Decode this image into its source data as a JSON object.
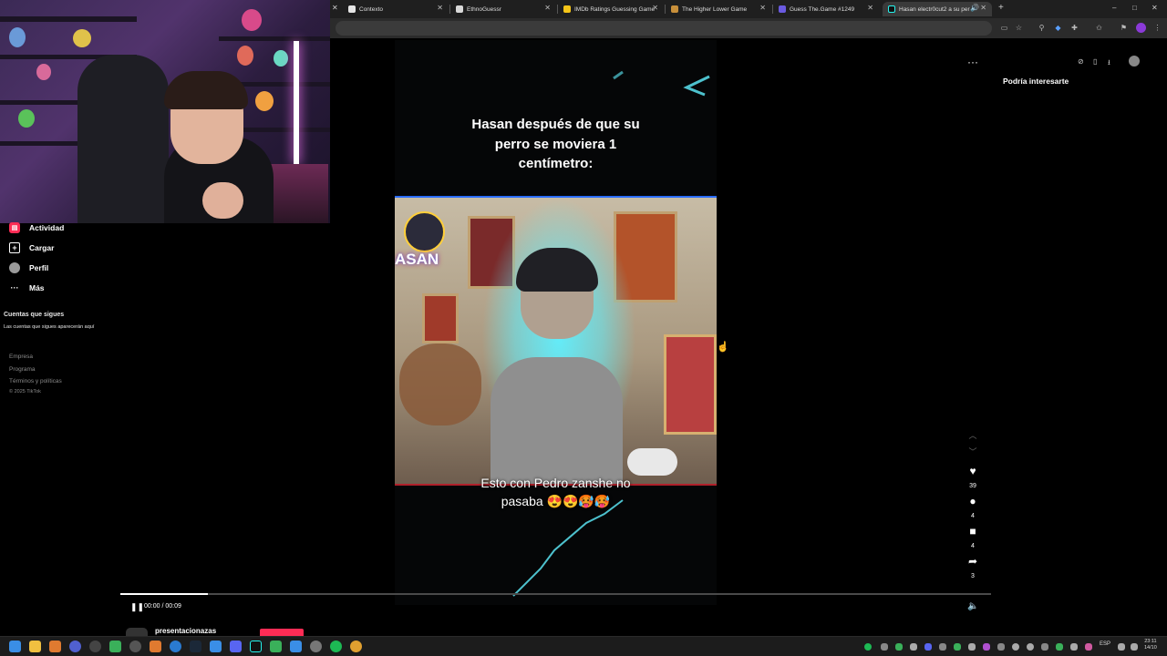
{
  "browser": {
    "tabs": [
      {
        "label": "Contexto"
      },
      {
        "label": "EthnoGuessr"
      },
      {
        "label": "IMDb Ratings Guessing Game"
      },
      {
        "label": "The Higher Lower Game"
      },
      {
        "label": "Guess The.Game #1249"
      },
      {
        "label": "Hasan electr0cut2 a su per"
      }
    ],
    "new_tab": "+",
    "window_controls": {
      "minimize": "–",
      "maximize": "□",
      "close": "✕"
    }
  },
  "sidebar": {
    "items": [
      {
        "label": "Actividad",
        "icon": "activity-icon"
      },
      {
        "label": "Cargar",
        "icon": "upload-icon"
      },
      {
        "label": "Perfil",
        "icon": "profile-avatar"
      },
      {
        "label": "Más",
        "icon": "more-icon"
      }
    ],
    "following_title": "Cuentas que sigues",
    "following_empty": "Las cuentas que sigues aparecerán aquí",
    "footer": [
      "Empresa",
      "Programa",
      "Términos y políticas",
      "© 2025 TikTok"
    ]
  },
  "video": {
    "caption_top": [
      "Hasan después de que su",
      "perro se moviera 1",
      "centímetro:"
    ],
    "caption_bottom": [
      "Esto con Pedro zanshe no",
      "pasaba 😍😍🥵🥵"
    ],
    "time": "00:00 / 00:09",
    "progress": 0.1
  },
  "actions": {
    "likes": "39",
    "comments": "4",
    "saves": "4",
    "shares": "3"
  },
  "right_rail": {
    "title": "Podría interesarte"
  },
  "bottom_bar": {
    "account_partial": "presentacionazas"
  },
  "taskbar": {
    "lang": "ESP",
    "time": "23:11",
    "date": "14/10"
  },
  "colors": {
    "glow": "#5ff0ff",
    "tiktok_red": "#fe2c55"
  }
}
